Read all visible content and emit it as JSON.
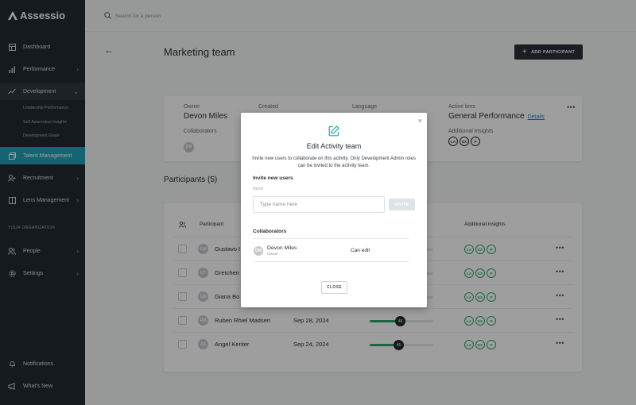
{
  "app": {
    "logo_text": "Assessio"
  },
  "sidebar": {
    "items": [
      {
        "label": "Dashboard",
        "icon": "dashboard-icon"
      },
      {
        "label": "Performance",
        "icon": "bar-chart-icon"
      },
      {
        "label": "Development",
        "icon": "trend-up-icon"
      },
      {
        "label": "Talent Management",
        "icon": "cards-icon"
      },
      {
        "label": "Recruitment",
        "icon": "user-plus-icon"
      },
      {
        "label": "Lens Management",
        "icon": "book-icon"
      },
      {
        "label": "People",
        "icon": "people-icon"
      },
      {
        "label": "Settings",
        "icon": "gear-icon"
      },
      {
        "label": "Notifications",
        "icon": "bell-icon"
      },
      {
        "label": "What's New",
        "icon": "megaphone-icon"
      }
    ],
    "development_sub": [
      "Leadership Performance",
      "Self Awareness Insights",
      "Development Goals"
    ],
    "section_label": "YOUR ORGANIZATION"
  },
  "search": {
    "placeholder": "Search for a person"
  },
  "page": {
    "title": "Marketing team",
    "add_button": "ADD PARTICIPANT"
  },
  "info": {
    "owner_label": "Owner",
    "owner": "Devon Miles",
    "created_label": "Created",
    "language_label": "Language",
    "active_lens_label": "Active lens",
    "active_lens": "General Performance",
    "details_link": "Details",
    "collaborators_label": "Collaborators",
    "collaborator_avatar": "DM",
    "additional_insights_label": "Additional insights",
    "insights": [
      "LA",
      "EX",
      "P"
    ]
  },
  "participants": {
    "title": "Participants (5)",
    "headers": {
      "participant": "Participant",
      "additional": "Additional insights"
    },
    "rows": [
      {
        "initials": "GM",
        "name": "Gustavo I",
        "date": "",
        "score": null
      },
      {
        "initials": "GT",
        "name": "Gretchen",
        "date": "",
        "score": null
      },
      {
        "initials": "GB",
        "name": "Giana Bo",
        "date": "",
        "score": null
      },
      {
        "initials": "RM",
        "name": "Ruben Rhiel Madsen",
        "date": "Sep 28, 2024",
        "score": 48
      },
      {
        "initials": "AK",
        "name": "Angel Kenter",
        "date": "Sep 24, 2024",
        "score": 45
      }
    ],
    "row_badges": [
      "LA",
      "EX",
      "P"
    ]
  },
  "modal": {
    "title": "Edit Activity team",
    "description": "Invite new users to collaborate on this activity. Only Development Admin roles can be invited to the activity team.",
    "invite_section": "Invite new users",
    "name_label": "Name",
    "name_placeholder": "Type name here",
    "invite_button": "INVITE",
    "collaborators_section": "Collaborators",
    "collaborator": {
      "initials": "DM",
      "name": "Devon Miles",
      "role": "Owner",
      "permission": "Can edit"
    },
    "close_button": "CLOSE"
  },
  "colors": {
    "accent": "#21a3b7",
    "sidebar": "#232a31",
    "success": "#2ea66b"
  }
}
